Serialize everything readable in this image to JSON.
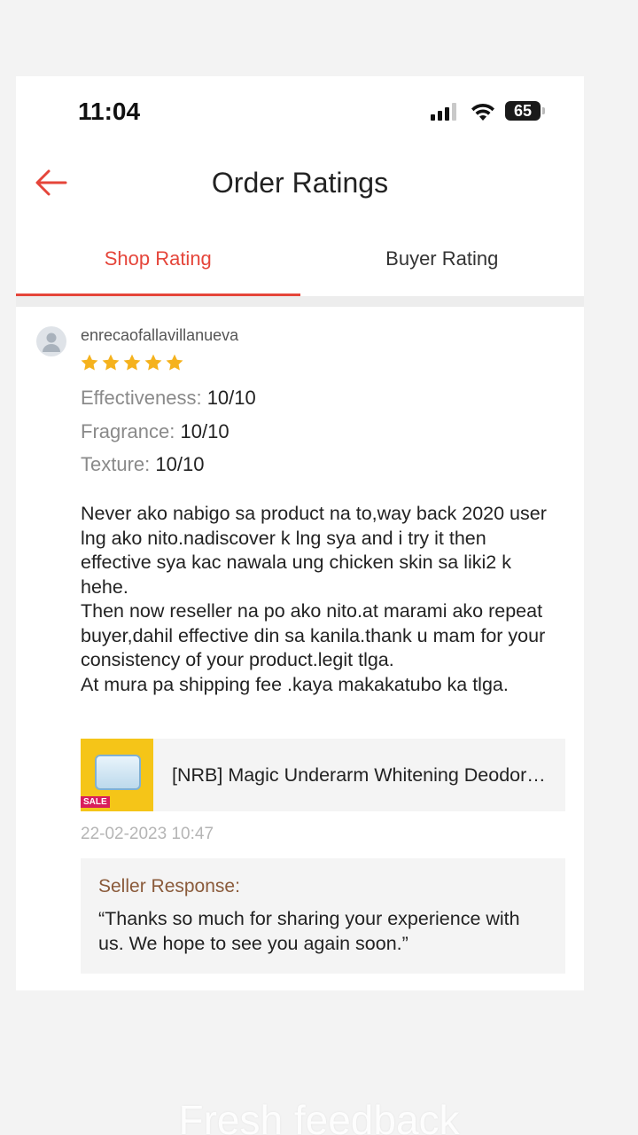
{
  "status_bar": {
    "time": "11:04",
    "battery": "65"
  },
  "header": {
    "title": "Order Ratings"
  },
  "tabs": [
    {
      "label": "Shop Rating",
      "active": true
    },
    {
      "label": "Buyer Rating",
      "active": false
    }
  ],
  "review": {
    "username": "enrecaofallavillanueva",
    "rating": 5,
    "attributes": [
      {
        "key": "Effectiveness:",
        "value": "10/10"
      },
      {
        "key": "Fragrance:",
        "value": "10/10"
      },
      {
        "key": "Texture:",
        "value": "10/10"
      }
    ],
    "text": "Never ako nabigo sa product na to,way back 2020 user lng ako nito.nadiscover k lng sya and i try it then effective sya kac nawala ung chicken skin sa liki2 k hehe.\nThen now reseller na po ako nito.at marami ako repeat buyer,dahil effective din sa kanila.thank u mam for your consistency of your product.legit tlga.\nAt mura pa shipping fee .kaya makakatubo ka tlga.",
    "product_name": "[NRB] Magic Underarm Whitening Deodorant",
    "product_badge": "SALE",
    "date": "22-02-2023 10:47",
    "seller_response_label": "Seller Response:",
    "seller_response_text": "“Thanks so much for sharing your experience with us. We hope to see you again soon.”"
  },
  "colors": {
    "accent": "#e5453a",
    "star": "#f5b21d",
    "seller_label": "#8a5a3a"
  },
  "caption": "Fresh feedback"
}
